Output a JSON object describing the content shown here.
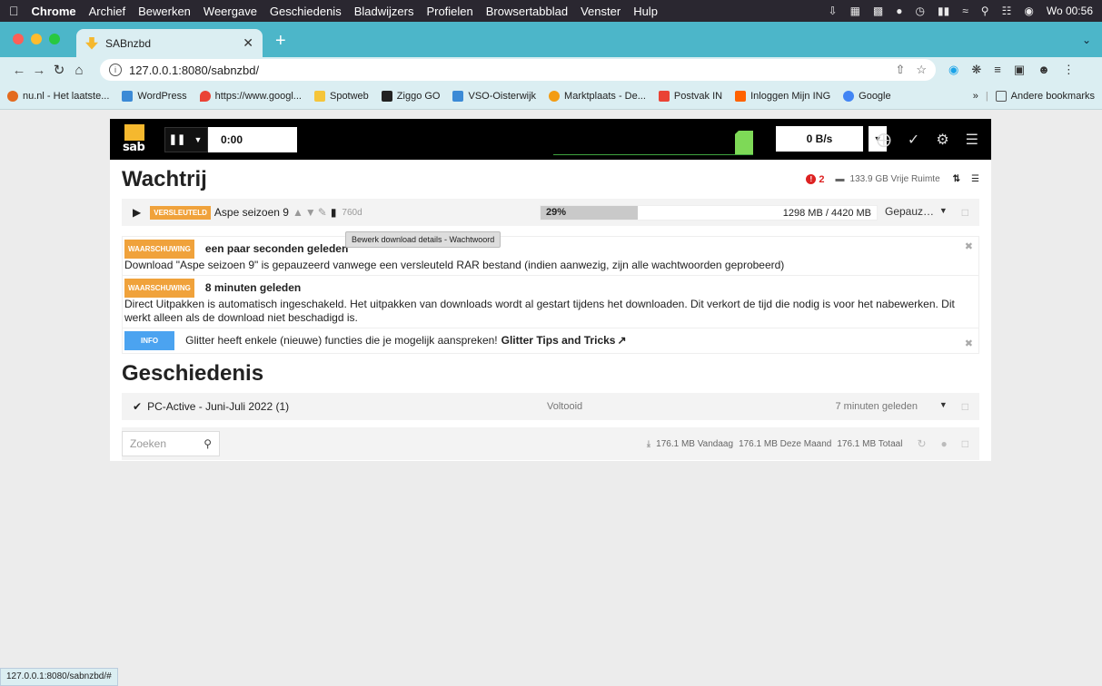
{
  "menubar": {
    "items": [
      "Chrome",
      "Archief",
      "Bewerken",
      "Weergave",
      "Geschiedenis",
      "Bladwijzers",
      "Profielen",
      "Browsertabblad",
      "Venster",
      "Hulp"
    ],
    "clock": "Wo 00:56"
  },
  "tab": {
    "title": "SABnzbd"
  },
  "address": {
    "url": "127.0.0.1:8080/sabnzbd/"
  },
  "bookmarks": {
    "items": [
      {
        "label": "nu.nl - Het laatste...",
        "color": "#e36b1f"
      },
      {
        "label": "WordPress",
        "color": "#3b8ad6"
      },
      {
        "label": "https://www.googl...",
        "color": "#ea4335"
      },
      {
        "label": "Spotweb",
        "color": "#f5c53a"
      },
      {
        "label": "Ziggo GO",
        "color": "#222222"
      },
      {
        "label": "VSO-Oisterwijk",
        "color": "#3b8ad6"
      },
      {
        "label": "Marktplaats - De...",
        "color": "#f39c12"
      },
      {
        "label": "Postvak IN",
        "color": "#ea4335"
      },
      {
        "label": "Inloggen Mijn ING",
        "color": "#ff6200"
      },
      {
        "label": "Google",
        "color": "#4285f4"
      }
    ],
    "other": "Andere bookmarks",
    "overflow": "»"
  },
  "sab": {
    "timer": "0:00",
    "speed": "0 B/s",
    "queue": {
      "title": "Wachtrij",
      "warnings_count": "2",
      "free_space": "133.9 GB Vrije Ruimte",
      "item": {
        "badge": "VERSLEUTELD",
        "name": "Aspe seizoen 9",
        "age": "760d",
        "percent_label": "29%",
        "percent": 29,
        "size": "1298 MB / 4420 MB",
        "status": "Gepauz…"
      },
      "tooltip": "Bewerk download details - Wachtwoord"
    },
    "messages": [
      {
        "badge": "WAARSCHUWING",
        "time": "een paar seconden geleden",
        "text": "Download \"Aspe seizoen 9\" is gepauzeerd vanwege een versleuteld RAR bestand (indien aanwezig, zijn alle wachtwoorden geprobeerd)"
      },
      {
        "badge": "WAARSCHUWING",
        "time": "8 minuten geleden",
        "text": "Direct Uitpakken is automatisch ingeschakeld. Het uitpakken van downloads wordt al gestart tijdens het downloaden. Dit verkort de tijd die nodig is voor het nabewerken. Dit werkt alleen als de download niet beschadigd is."
      },
      {
        "badge": "INFO",
        "text": "Glitter heeft enkele (nieuwe) functies die je mogelijk aanspreken!",
        "link": "Glitter Tips and Tricks"
      }
    ],
    "history": {
      "title": "Geschiedenis",
      "item": {
        "name": "PC-Active - Juni-Juli 2022 (1)",
        "status": "Voltooid",
        "time": "7 minuten geleden"
      }
    },
    "footer": {
      "search_placeholder": "Zoeken",
      "today": "176.1 MB Vandaag",
      "month": "176.1 MB Deze Maand",
      "total": "176.1 MB Totaal"
    }
  },
  "statusbar": "127.0.0.1:8080/sabnzbd/#"
}
